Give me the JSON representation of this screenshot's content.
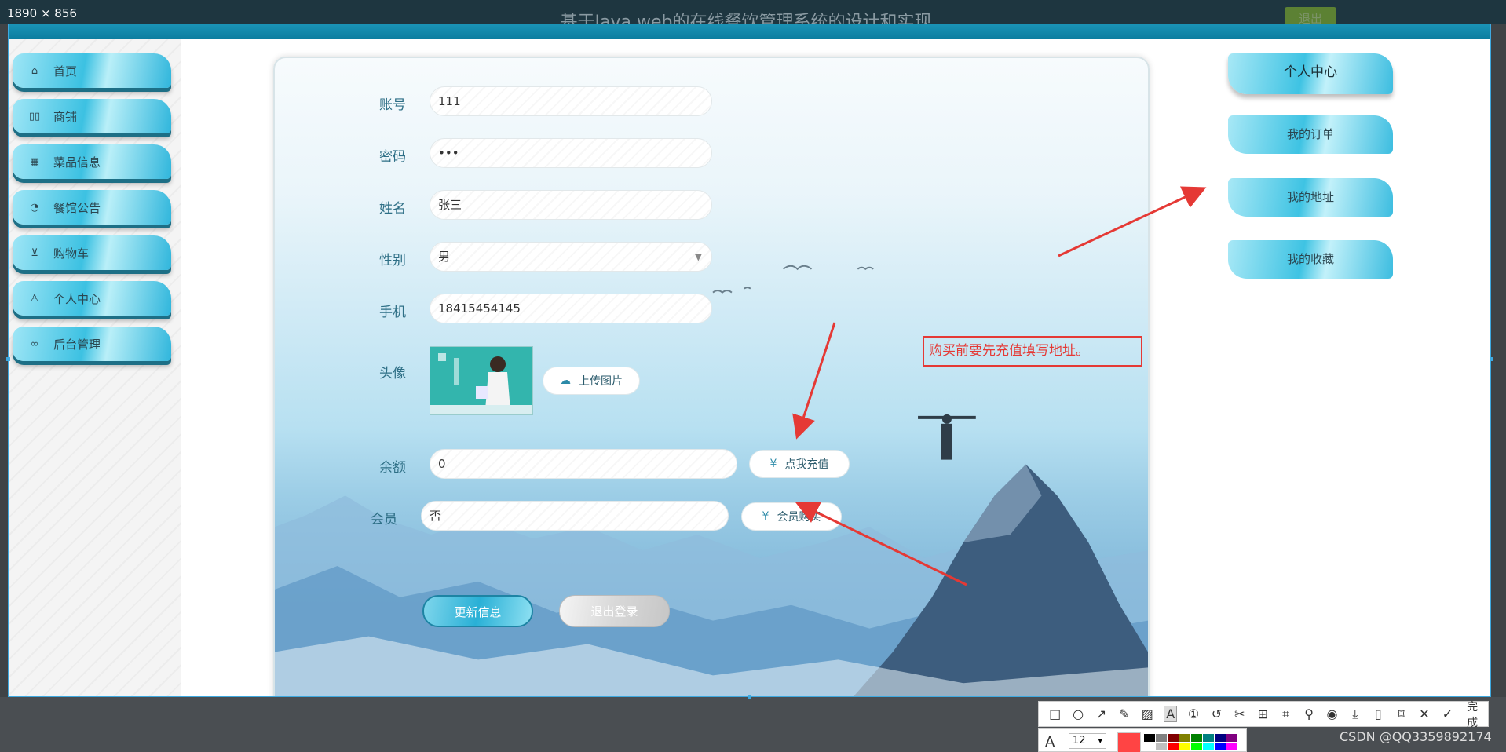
{
  "screenshot_badge": "1890 × 856",
  "app": {
    "title": "基于Java web的在线餐饮管理系统的设计和实现",
    "logout_label": "退出"
  },
  "sidebar": {
    "items": [
      {
        "label": "首页",
        "icon": "home-icon"
      },
      {
        "label": "商铺",
        "icon": "shop-icon"
      },
      {
        "label": "菜品信息",
        "icon": "dish-icon"
      },
      {
        "label": "餐馆公告",
        "icon": "notice-icon"
      },
      {
        "label": "购物车",
        "icon": "cart-icon"
      },
      {
        "label": "个人中心",
        "icon": "user-icon"
      },
      {
        "label": "后台管理",
        "icon": "link-icon"
      }
    ]
  },
  "form": {
    "account": {
      "label": "账号",
      "value": "111"
    },
    "password": {
      "label": "密码",
      "value": "•••"
    },
    "name": {
      "label": "姓名",
      "value": "张三"
    },
    "gender": {
      "label": "性别",
      "value": "男"
    },
    "phone": {
      "label": "手机",
      "value": "18415454145"
    },
    "avatar": {
      "label": "头像",
      "upload_label": "上传图片"
    },
    "balance": {
      "label": "余额",
      "value": "0",
      "recharge_label": "点我充值"
    },
    "member": {
      "label": "会员",
      "value": "否",
      "buy_label": "会员购买"
    },
    "update_label": "更新信息",
    "logout_label": "退出登录"
  },
  "right_menu": {
    "title": "个人中心",
    "items": [
      "我的订单",
      "我的地址",
      "我的收藏"
    ]
  },
  "annotation": {
    "text": "购买前要先充值填写地址。",
    "color": "#e53935"
  },
  "snip_toolbar": {
    "done_label": "完成",
    "font_size": "12",
    "current_color": "#ff4444",
    "palette": [
      "#000000",
      "#808080",
      "#800000",
      "#808000",
      "#008000",
      "#008080",
      "#000080",
      "#800080",
      "#ffffff",
      "#c0c0c0",
      "#ff0000",
      "#ffff00",
      "#00ff00",
      "#00ffff",
      "#0000ff",
      "#ff00ff"
    ]
  },
  "watermark": "CSDN @QQ3359892174"
}
